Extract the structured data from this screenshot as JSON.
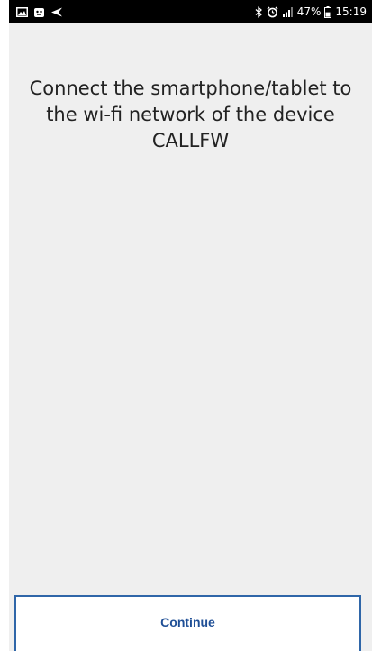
{
  "status_bar": {
    "left_icons": [
      "gallery-icon",
      "android-app-icon",
      "send-icon"
    ],
    "right_icons": [
      "bluetooth-icon",
      "alarm-icon",
      "signal-icon",
      "battery-icon"
    ],
    "battery": "47%",
    "time": "15:19"
  },
  "main": {
    "instruction": "Connect the smartphone/tablet to the wi-fi network of the device CALLFW"
  },
  "footer": {
    "continue_label": "Continue"
  },
  "colors": {
    "background": "#efefef",
    "accent": "#2f66a8",
    "button_text": "#1f4f96"
  }
}
